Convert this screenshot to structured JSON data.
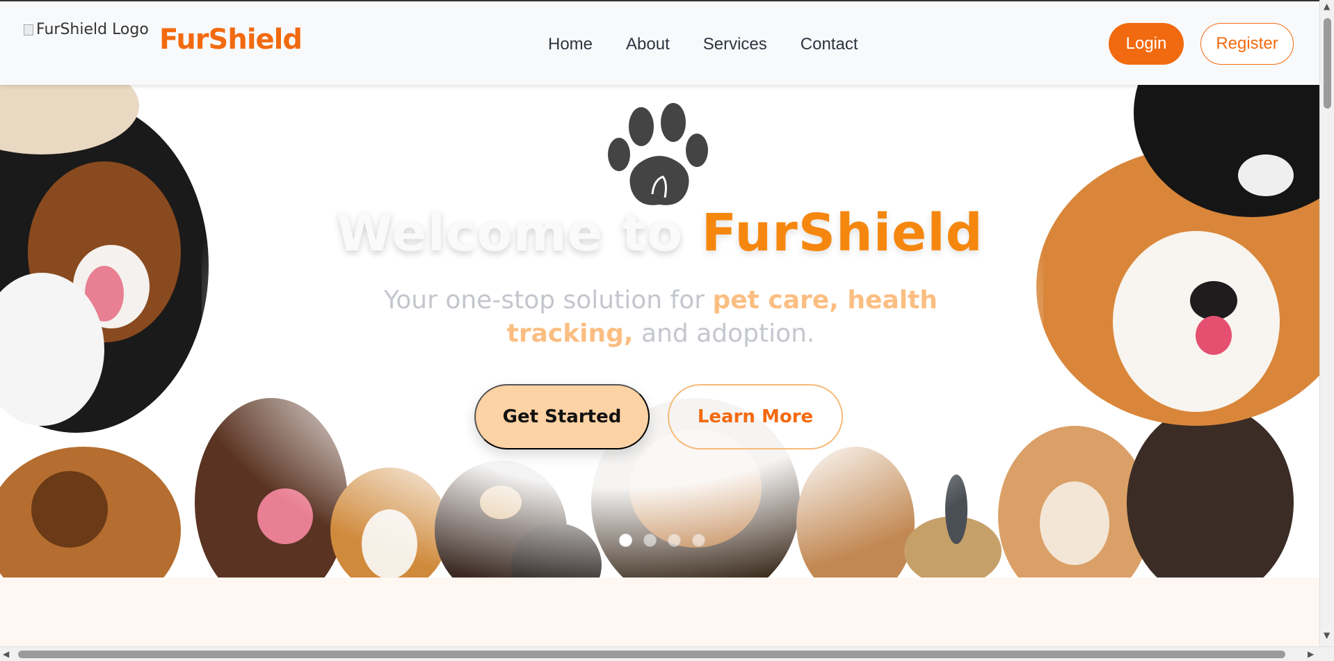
{
  "header": {
    "logo_alt": "FurShield Logo",
    "brand": "FurShield",
    "nav": [
      {
        "label": "Home"
      },
      {
        "label": "About"
      },
      {
        "label": "Services"
      },
      {
        "label": "Contact"
      }
    ],
    "login_label": "Login",
    "register_label": "Register"
  },
  "hero": {
    "title_white": "Welcome to",
    "title_orange": "FurShield",
    "subtitle_pre": "Your one-stop solution for",
    "subtitle_highlight_1": "pet care, health",
    "subtitle_highlight_2": "tracking,",
    "subtitle_post": "and adoption.",
    "get_started_label": "Get Started",
    "learn_more_label": "Learn More",
    "carousel": {
      "slides": 4,
      "active": 1
    }
  },
  "colors": {
    "accent": "#f26a0f",
    "title_orange": "#f5870f",
    "light_orange": "#fdd2a4",
    "nav_text": "#2b3540"
  },
  "icons": [
    "paw-icon",
    "broken-image-icon"
  ]
}
